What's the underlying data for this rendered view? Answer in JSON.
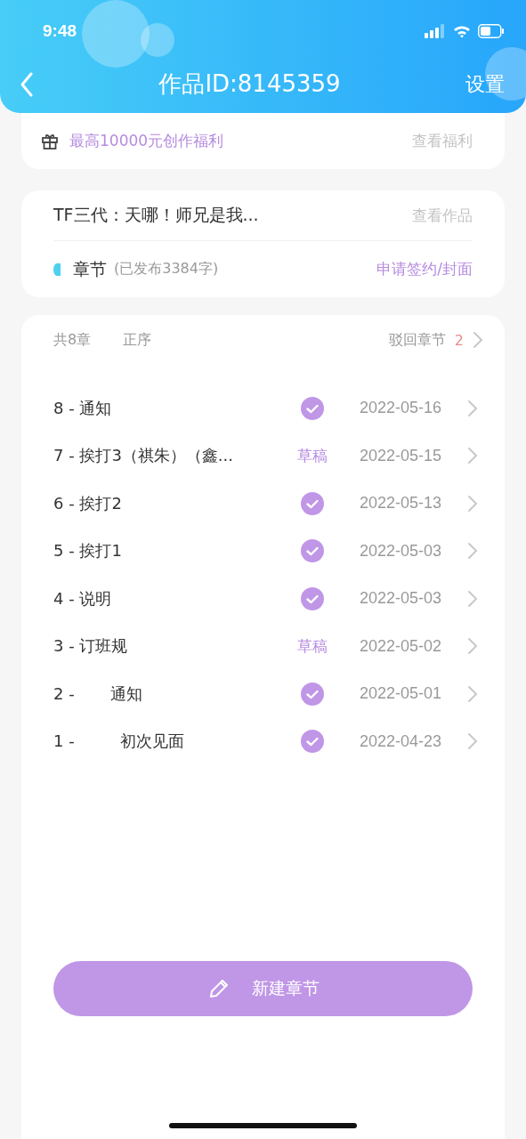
{
  "status_bar": {
    "time": "9:48"
  },
  "header": {
    "title": "作品ID:8145359",
    "action": "设置"
  },
  "benefit": {
    "text": "最高10000元创作福利",
    "link": "查看福利"
  },
  "work": {
    "title": "TF三代：天哪！师兄是我...",
    "link": "查看作品",
    "section": "章节",
    "published": "(已发布3384字)",
    "apply": "申请签约/封面"
  },
  "chapters_bar": {
    "count": "共8章",
    "order": "正序",
    "rejected_label": "驳回章节",
    "rejected_count": "2"
  },
  "chapters": [
    {
      "title": "8 - 通知",
      "kind": "published",
      "date": "2022-05-16"
    },
    {
      "title": "7 - 挨打3（祺朱）（鑫...",
      "kind": "draft",
      "status_label": "草稿",
      "date": "2022-05-15"
    },
    {
      "title": "6 - 挨打2",
      "kind": "published",
      "date": "2022-05-13"
    },
    {
      "title": "5 - 挨打1",
      "kind": "published",
      "date": "2022-05-03"
    },
    {
      "title": "4 - 说明",
      "kind": "published",
      "date": "2022-05-03"
    },
    {
      "title": "3 - 订班规",
      "kind": "draft",
      "status_label": "草稿",
      "date": "2022-05-02"
    },
    {
      "title": "2 -       通知",
      "kind": "published",
      "date": "2022-05-01"
    },
    {
      "title": "1 -         初次见面",
      "kind": "published",
      "date": "2022-04-23"
    }
  ],
  "new_chapter_button": "新建章节"
}
